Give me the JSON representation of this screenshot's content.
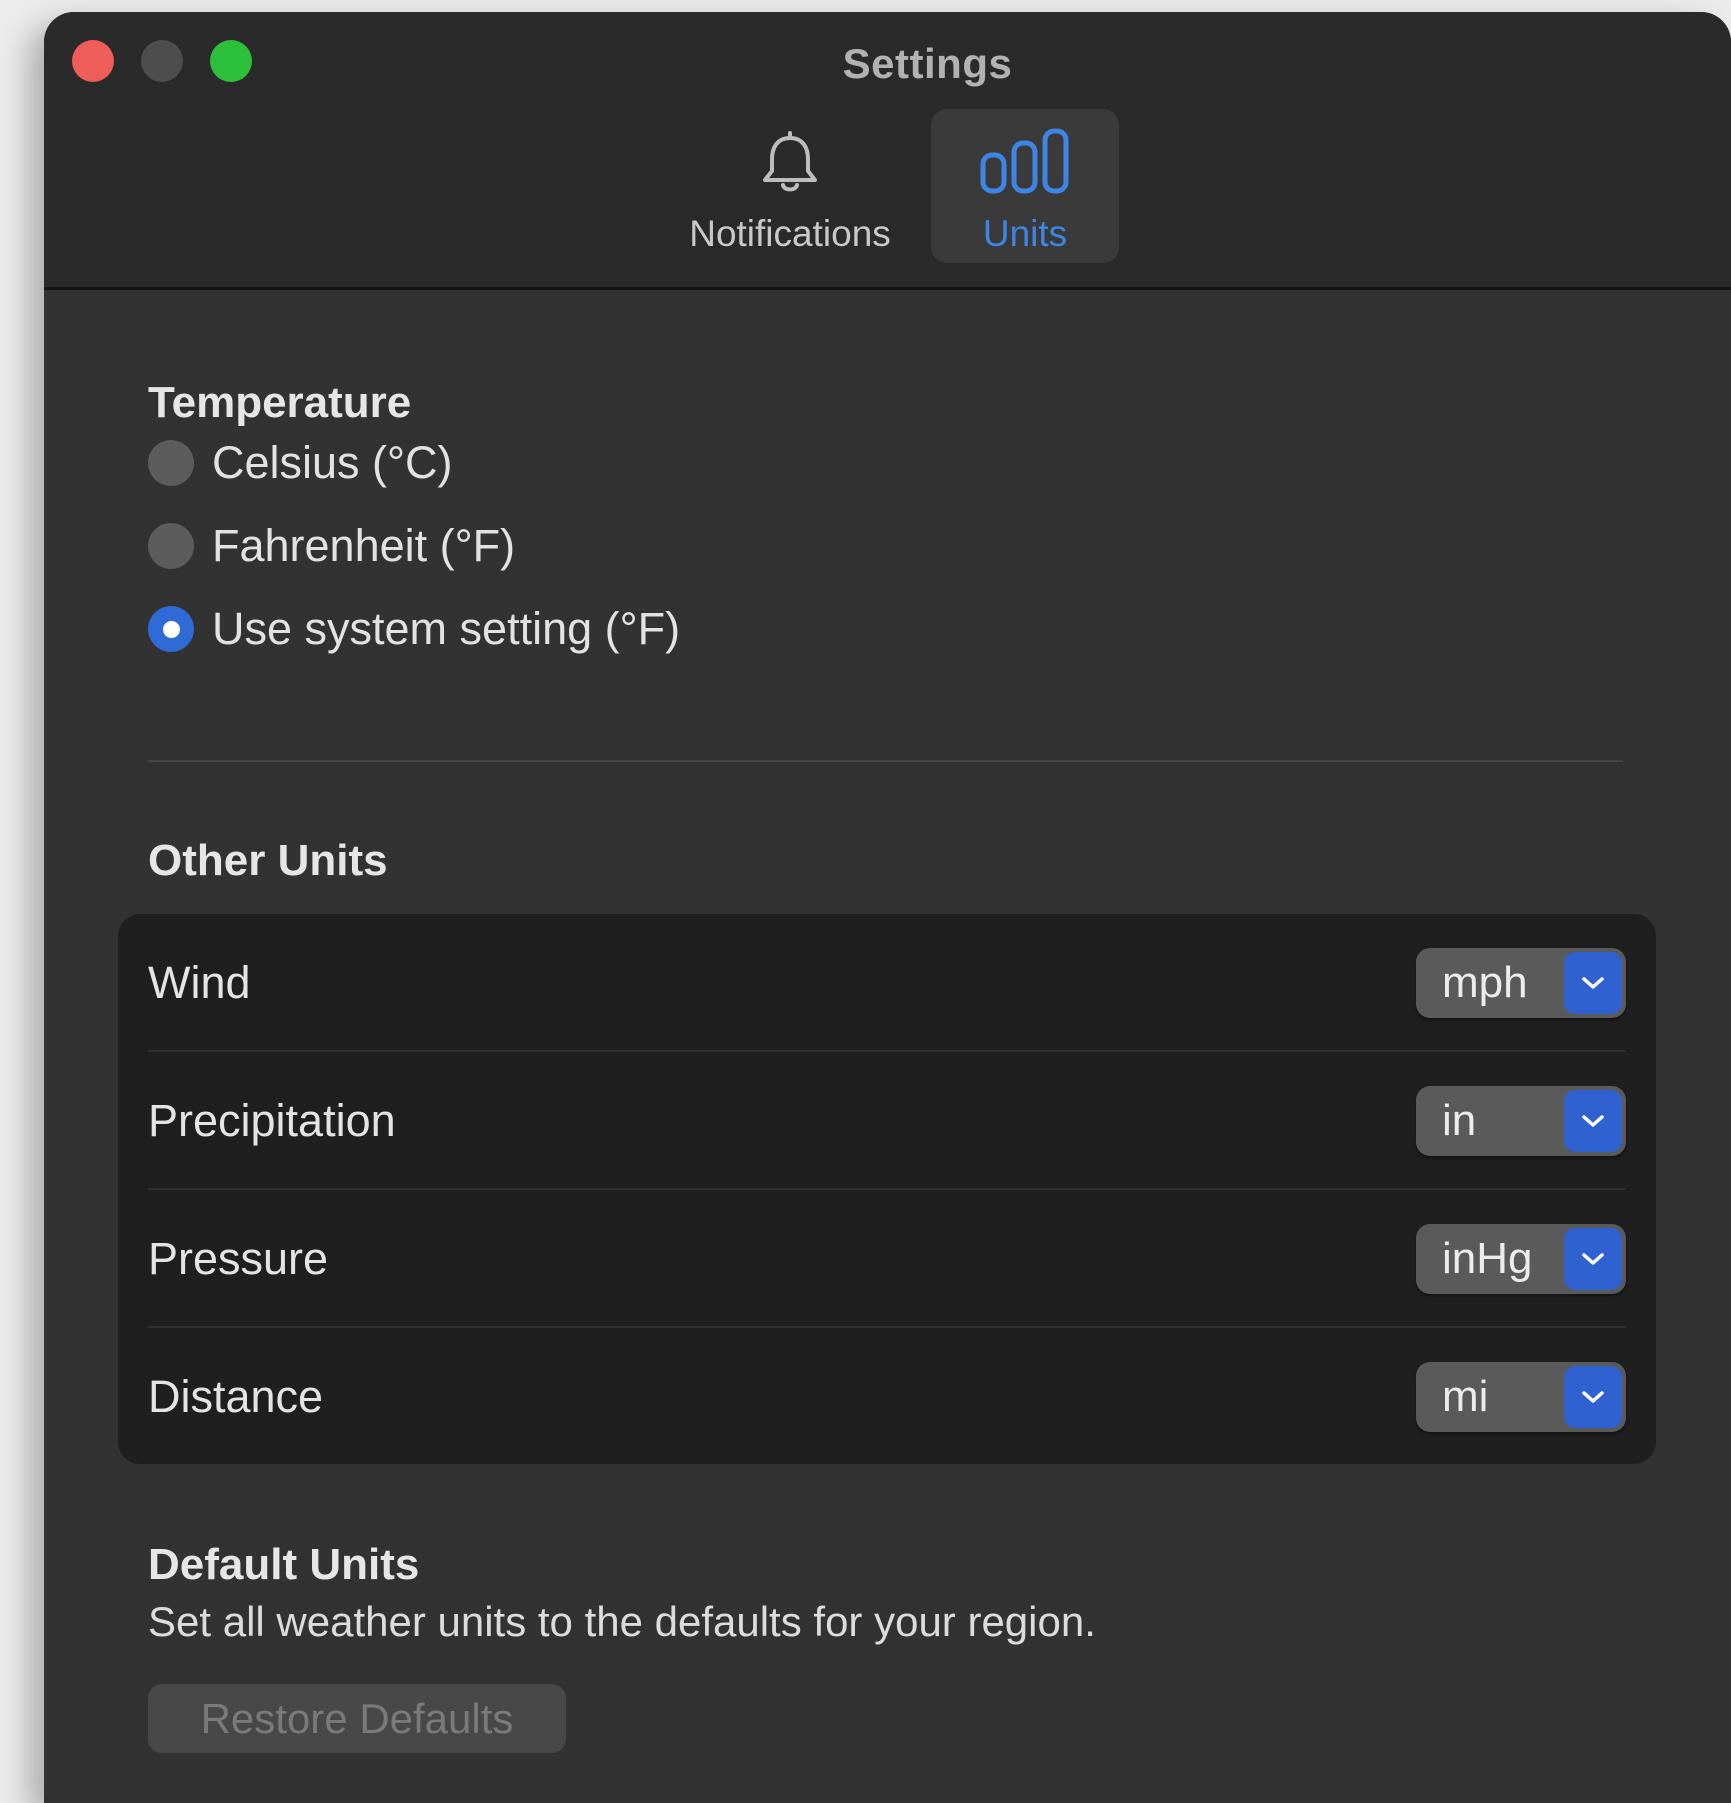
{
  "window": {
    "title": "Settings"
  },
  "tabs": [
    {
      "label": "Notifications",
      "icon": "bell-icon",
      "selected": false
    },
    {
      "label": "Units",
      "icon": "bar-chart-icon",
      "selected": true
    }
  ],
  "temperature": {
    "heading": "Temperature",
    "options": [
      {
        "label": "Celsius (°C)",
        "checked": false
      },
      {
        "label": "Fahrenheit (°F)",
        "checked": false
      },
      {
        "label": "Use system setting (°F)",
        "checked": true
      }
    ]
  },
  "other_units": {
    "heading": "Other Units",
    "rows": [
      {
        "label": "Wind",
        "value": "mph"
      },
      {
        "label": "Precipitation",
        "value": "in"
      },
      {
        "label": "Pressure",
        "value": "inHg"
      },
      {
        "label": "Distance",
        "value": "mi"
      }
    ]
  },
  "default_units": {
    "heading": "Default Units",
    "description": "Set all weather units to the defaults for your region.",
    "button_label": "Restore Defaults",
    "button_enabled": false
  },
  "colors": {
    "accent": "#2f6bd6",
    "tab_selected_text": "#3d86e6",
    "close": "#ee5d57",
    "zoom": "#2dc13b"
  }
}
